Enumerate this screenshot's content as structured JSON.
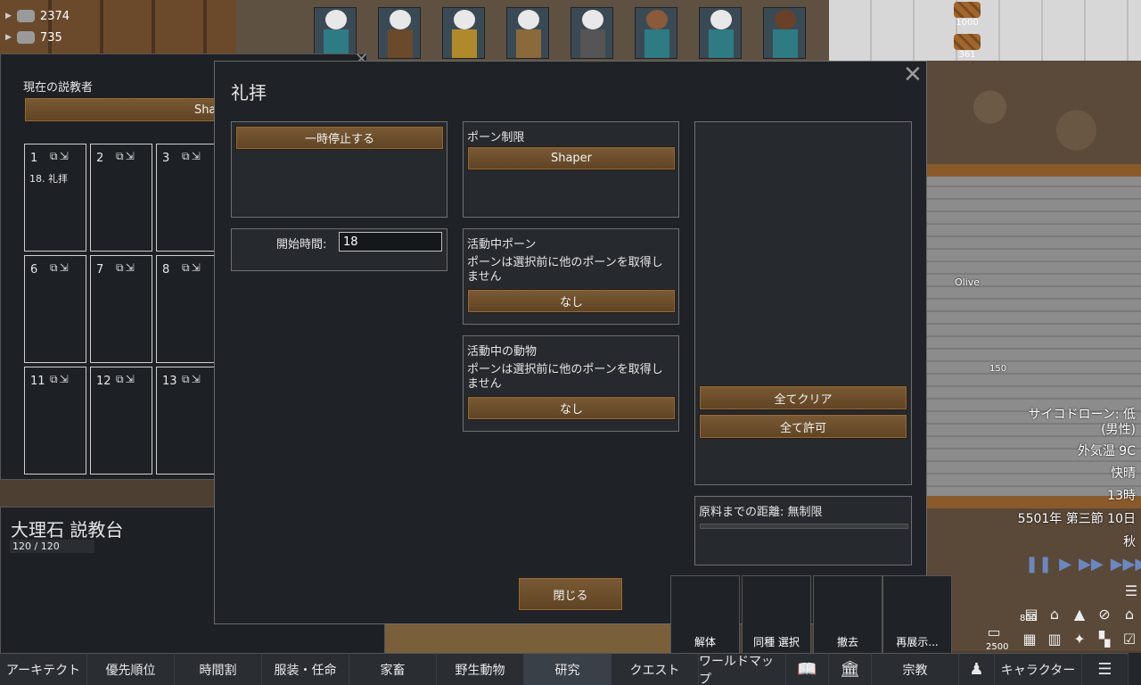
{
  "resources": [
    {
      "name": "silver-icon",
      "value": "2374"
    },
    {
      "name": "component-icon",
      "value": "735"
    }
  ],
  "stockpiles": [
    {
      "value": "1000"
    },
    {
      "value": "361"
    }
  ],
  "preacher_panel": {
    "current_preacher_label": "現在の説教者",
    "preacher_name": "Shaper",
    "slots": [
      {
        "num": "1",
        "text": "18. 礼拝"
      },
      {
        "num": "2",
        "text": ""
      },
      {
        "num": "3",
        "text": ""
      },
      {
        "num": "6",
        "text": ""
      },
      {
        "num": "7",
        "text": ""
      },
      {
        "num": "8",
        "text": ""
      },
      {
        "num": "11",
        "text": ""
      },
      {
        "num": "12",
        "text": ""
      },
      {
        "num": "13",
        "text": ""
      }
    ]
  },
  "inspect": {
    "title": "大理石 説教台",
    "hp": "120 / 120"
  },
  "dialog": {
    "title": "礼拝",
    "pause_button": "一時停止する",
    "start_time_label": "開始時間:",
    "start_time_value": "18",
    "pawn_restriction_label": "ポーン制限",
    "pawn_restriction_value": "Shaper",
    "active_pawn_label": "活動中ポーン",
    "active_pawn_desc": "ポーンは選択前に他のポーンを取得しません",
    "active_pawn_value": "なし",
    "active_animal_label": "活動中の動物",
    "active_animal_desc": "ポーンは選択前に他のポーンを取得しません",
    "active_animal_value": "なし",
    "clear_all_button": "全てクリア",
    "allow_all_button": "全て許可",
    "distance_label": "原料までの距離: 無制限",
    "close_button": "閉じる"
  },
  "hud": {
    "pawn_name": "Olive",
    "item_count": "150",
    "psychic_drone": "サイコドローン: 低",
    "psychic_drone_gender": "(男性)",
    "outdoor_temp": "外気温 9C",
    "weather": "快晴",
    "hour": "13時",
    "date": "5501年 第三節 10日",
    "season": "秋",
    "stack_counts": [
      "800",
      "2500"
    ]
  },
  "tool_buttons": [
    {
      "label": "解体"
    },
    {
      "label": "同種 選択"
    },
    {
      "label": "撤去"
    },
    {
      "label": "再展示..."
    }
  ],
  "tabs": [
    {
      "label": "アーキテクト"
    },
    {
      "label": "優先順位"
    },
    {
      "label": "時間割"
    },
    {
      "label": "服装・任命"
    },
    {
      "label": "家畜"
    },
    {
      "label": "野生動物"
    },
    {
      "label": "研究"
    },
    {
      "label": "クエスト"
    },
    {
      "label": "ワールドマップ"
    },
    {
      "label": "宗教"
    },
    {
      "label": "キャラクター"
    }
  ]
}
